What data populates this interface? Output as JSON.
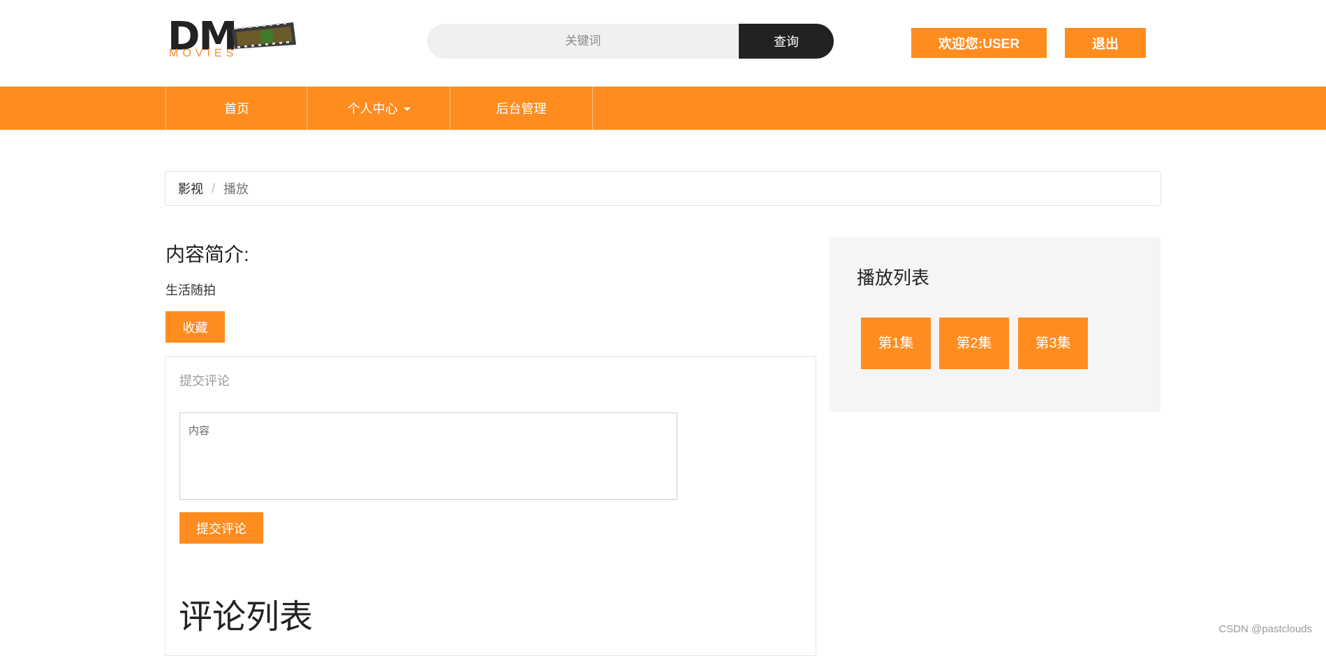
{
  "header": {
    "logo": {
      "main": "DM",
      "sub": "MOVIES"
    },
    "search": {
      "placeholder": "关键词",
      "button_label": "查询"
    },
    "welcome_label": "欢迎您:USER",
    "logout_label": "退出"
  },
  "nav": {
    "items": [
      {
        "label": "首页"
      },
      {
        "label": "个人中心"
      },
      {
        "label": "后台管理"
      }
    ]
  },
  "breadcrumb": {
    "home": "影视",
    "separator": "/",
    "current": "播放"
  },
  "detail": {
    "intro_title": "内容简介:",
    "intro_text": "生活随拍",
    "favorite_label": "收藏"
  },
  "comment": {
    "heading": "提交评论",
    "textarea_placeholder": "内容",
    "submit_label": "提交评论",
    "list_title": "评论列表"
  },
  "playlist": {
    "title": "播放列表",
    "episodes": [
      "第1集",
      "第2集",
      "第3集"
    ]
  },
  "watermark": "CSDN @pastclouds",
  "colors": {
    "accent": "#ff8c1f",
    "dark": "#222222",
    "panel": "#f5f5f5"
  }
}
